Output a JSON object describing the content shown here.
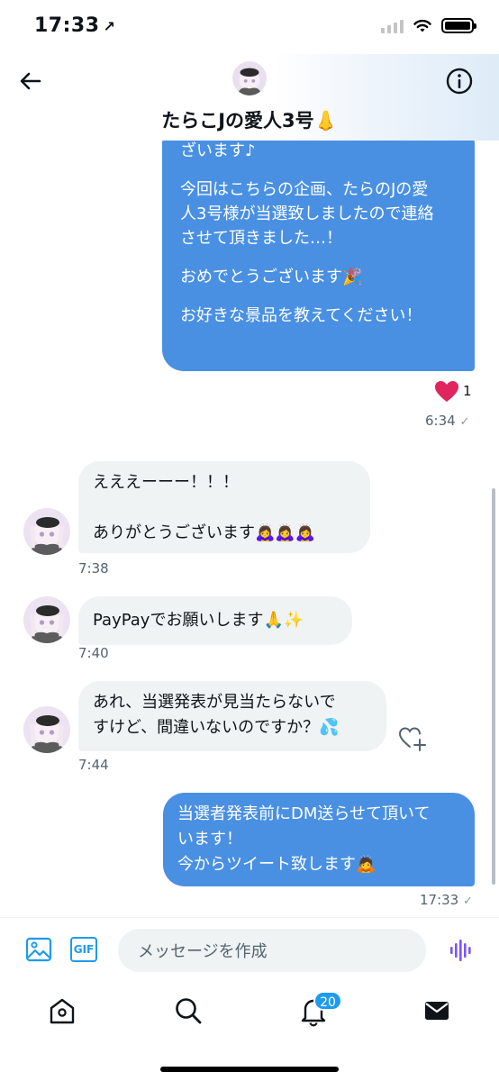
{
  "status_bar": {
    "time": "17:33",
    "location_arrow": "↗"
  },
  "header": {
    "title": "たらこJの愛人3号👃",
    "back_icon": "back-arrow-icon",
    "info_icon": "info-icon"
  },
  "messages": [
    {
      "direction": "outgoing",
      "lines": [
        "ざいます♪",
        "",
        "今回はこちらの企画、たらのJの愛",
        "人3号様が当選致しましたので連絡",
        "させて頂きました…！",
        "",
        "おめでとうございます🎉",
        "",
        "お好きな景品を教えてください！"
      ],
      "reaction": {
        "icon": "heart-icon",
        "count": "1"
      },
      "time": "6:34"
    },
    {
      "direction": "incoming",
      "lines": [
        "えええーーー！！！",
        "",
        "ありがとうございます🙇‍♀️🙇‍♀️🙇‍♀️"
      ],
      "time": "7:38"
    },
    {
      "direction": "incoming",
      "lines": [
        "PayPayでお願いします🙏✨"
      ],
      "time": "7:40"
    },
    {
      "direction": "incoming",
      "lines": [
        "あれ、当選発表が見当たらないで",
        "すけど、間違いないのですか？💦"
      ],
      "time": "7:44"
    },
    {
      "direction": "outgoing",
      "lines": [
        "当選者発表前にDM送らせて頂いて",
        "います！",
        "今からツイート致します🙇"
      ],
      "time": "17:33"
    }
  ],
  "composer": {
    "placeholder": "メッセージを作成",
    "image_icon": "image-icon",
    "gif_label": "GIF",
    "voice_icon": "voice-icon"
  },
  "tabbar": {
    "notifications_badge": "20"
  },
  "colors": {
    "outgoing_bubble": "#4a90e2",
    "incoming_bubble": "#eff3f4",
    "accent": "#1d9bf0",
    "heart": "#e0245e"
  }
}
